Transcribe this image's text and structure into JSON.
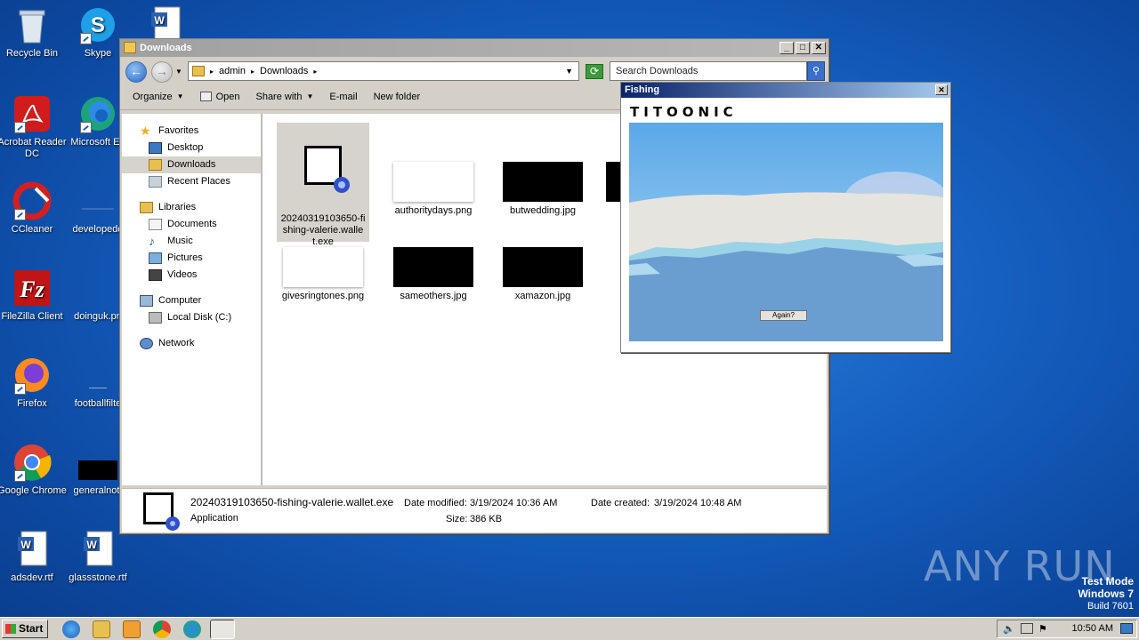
{
  "desktop": {
    "icons": [
      {
        "label": "Recycle Bin"
      },
      {
        "label": "Skype"
      },
      {
        "label": "Acrobat Reader DC"
      },
      {
        "label": "Microsoft Ed"
      },
      {
        "label": "CCleaner"
      },
      {
        "label": "developedd"
      },
      {
        "label": "FileZilla Client"
      },
      {
        "label": "doinguk.pn"
      },
      {
        "label": "Firefox"
      },
      {
        "label": "footballfilte"
      },
      {
        "label": "Google Chrome"
      },
      {
        "label": "generalnot."
      },
      {
        "label": "adsdev.rtf"
      },
      {
        "label": "glassstone.rtf"
      }
    ]
  },
  "explorer": {
    "title": "Downloads",
    "address": {
      "parts": [
        "admin",
        "Downloads"
      ]
    },
    "search_placeholder": "Search Downloads",
    "toolbar": {
      "organize": "Organize",
      "open": "Open",
      "share_with": "Share with",
      "email": "E-mail",
      "new_folder": "New folder"
    },
    "nav": {
      "favorites": "Favorites",
      "desktop": "Desktop",
      "downloads": "Downloads",
      "recent_places": "Recent Places",
      "libraries": "Libraries",
      "documents": "Documents",
      "music": "Music",
      "pictures": "Pictures",
      "videos": "Videos",
      "computer": "Computer",
      "local_disk": "Local Disk (C:)",
      "network": "Network"
    },
    "files": [
      {
        "name": "20240319103650-fishing-valerie.wallet.exe"
      },
      {
        "name": "authoritydays.png"
      },
      {
        "name": "butwedding.jpg"
      },
      {
        "name": "givesringtones.png"
      },
      {
        "name": "sameothers.jpg"
      },
      {
        "name": "xamazon.jpg"
      }
    ],
    "details": {
      "filename": "20240319103650-fishing-valerie.wallet.exe",
      "type": "Application",
      "date_modified_label": "Date modified:",
      "date_modified": "3/19/2024 10:36 AM",
      "date_created_label": "Date created:",
      "date_created": "3/19/2024 10:48 AM",
      "size_label": "Size:",
      "size": "386 KB"
    }
  },
  "fishing": {
    "title": "Fishing",
    "brand": "TITOONIC",
    "button": "Again?"
  },
  "taskbar": {
    "start": "Start",
    "clock": "10:50 AM"
  },
  "watermark": {
    "line1": "Test Mode",
    "line2": "Windows 7",
    "line3": "Build 7601",
    "anyrun": "ANY RUN"
  }
}
